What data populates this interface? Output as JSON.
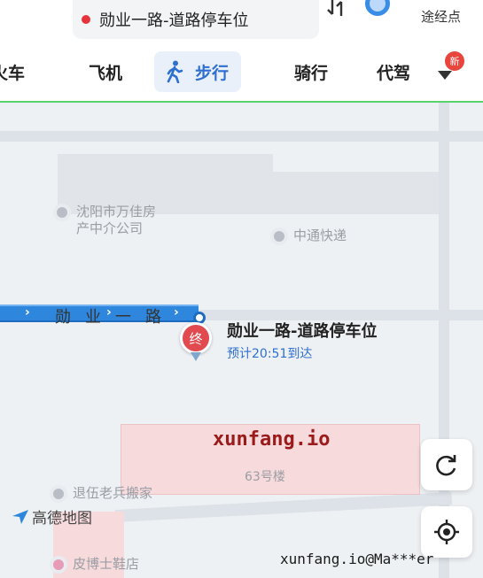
{
  "header": {
    "destination": "勋业一路-道路停车位",
    "waypoint_label": "途经点",
    "modes": [
      {
        "label": "火车"
      },
      {
        "label": "飞机"
      },
      {
        "label": "步行",
        "icon": "walker-icon",
        "active": true
      },
      {
        "label": "骑行"
      },
      {
        "label": "代驾"
      }
    ],
    "more_badge": "新",
    "accent_color": "#2e6fcf"
  },
  "map": {
    "pois": [
      {
        "name": "沈阳市万佳房\n产中介公司"
      },
      {
        "name": "中通快递"
      },
      {
        "name": "退伍老兵搬家"
      },
      {
        "name": "皮博士鞋店"
      }
    ],
    "road_name": "勋业一路",
    "end_marker": "终",
    "destination_label": "勋业一路-道路停车位",
    "eta": "预计20:51到达",
    "building_label": "63号楼",
    "logo": "高德地图",
    "route_color": "#2f87dd"
  },
  "watermarks": {
    "main": "xunfang.io",
    "corner": "xunfang.io@Ma***er"
  }
}
